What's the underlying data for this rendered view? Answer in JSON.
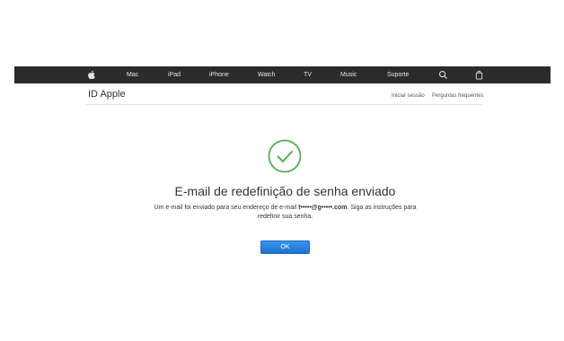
{
  "globalnav": {
    "apple_icon": "apple-logo-icon",
    "items": [
      "Mac",
      "iPad",
      "iPhone",
      "Watch",
      "TV",
      "Music",
      "Suporte"
    ],
    "search_icon": "search-icon",
    "bag_icon": "shopping-bag-icon"
  },
  "localnav": {
    "title": "ID Apple",
    "links": [
      "Iniciar sessão",
      "Perguntas frequentes"
    ]
  },
  "main": {
    "status_icon": "success-checkmark-icon",
    "accent_color": "#4cb34c",
    "headline": "E-mail de redefinição de senha enviado",
    "desc_prefix": "Um e-mail foi enviado para seu endereço de e-mail ",
    "desc_email": "t•••••@g•••••.com",
    "desc_suffix": ". Siga as instruções para redefinir sua senha.",
    "ok_label": "OK",
    "button_color": "#1e7ad6"
  }
}
